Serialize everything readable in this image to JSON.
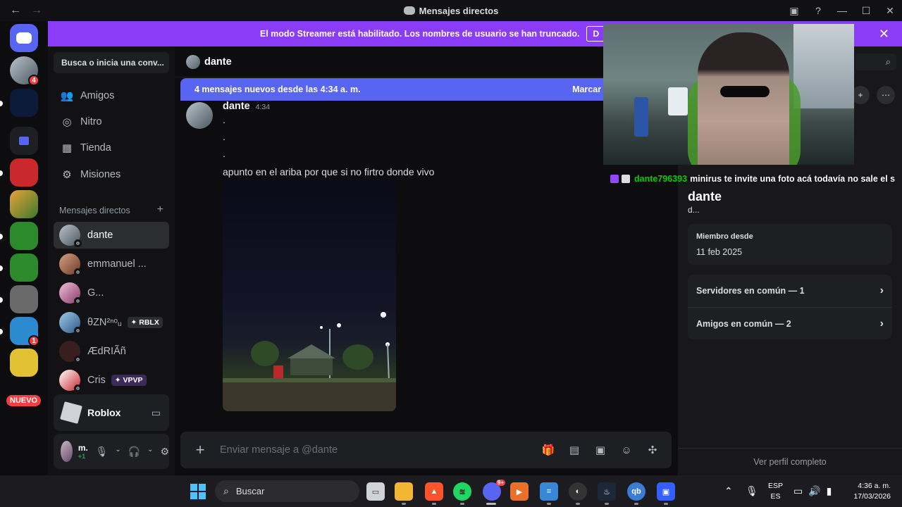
{
  "window": {
    "title": "Mensajes directos"
  },
  "banner": {
    "text": "El modo Streamer está habilitado. Los nombres de usuario se han truncado.",
    "button": "D"
  },
  "rail": {
    "badge_dm": "4",
    "badge_server": "1",
    "nuevo": "NUEVO"
  },
  "sidebar": {
    "search_label": "Busca o inicia una conv...",
    "nav": [
      {
        "label": "Amigos",
        "icon": "friends-icon"
      },
      {
        "label": "Nitro",
        "icon": "nitro-icon"
      },
      {
        "label": "Tienda",
        "icon": "shop-icon"
      },
      {
        "label": "Misiones",
        "icon": "quests-icon"
      }
    ],
    "dm_header": "Mensajes directos",
    "dms": [
      {
        "name": "dante",
        "tag": ""
      },
      {
        "name": "emmanuel ...",
        "tag": ""
      },
      {
        "name": "G...",
        "tag": ""
      },
      {
        "name": "θZN²ⁿᵒᵤ",
        "tag": "RBLX"
      },
      {
        "name": "ÆdRIÃñ",
        "tag": ""
      },
      {
        "name": "Cris",
        "tag": "VPVP"
      }
    ],
    "game": {
      "name": "Roblox"
    },
    "user": {
      "name": "m...",
      "status": "+1"
    }
  },
  "chat": {
    "header_name": "dante",
    "new_messages": "4 mensajes nuevos desde las 4:34 a. m.",
    "mark_read": "Marcar cor",
    "message": {
      "author": "dante",
      "time": "4:34",
      "lines": [
        ".",
        ".",
        ".",
        "apunto en el ariba por que si no firtro donde vivo"
      ]
    },
    "input_placeholder": "Enviar mensaje a @dante"
  },
  "overlay": {
    "chat_user": "dante796393",
    "chat_text": "minirus te invite una foto acá todavía no sale el s"
  },
  "profile": {
    "name": "dante",
    "sub": "d...",
    "member_since_label": "Miembro desde",
    "member_since_value": "11 feb 2025",
    "servers_common": "Servidores en común — 1",
    "friends_common": "Amigos en común — 2",
    "view_full": "Ver perfil completo"
  },
  "taskbar": {
    "search": "Buscar",
    "discord_badge": "9+",
    "lang_top": "ESP",
    "lang_bottom": "ES",
    "time": "4:36 a. m.",
    "date": "17/03/2026"
  },
  "colors": {
    "brand": "#5865f2",
    "streamer": "#8a3cf6",
    "accent_green": "#23a55a"
  }
}
